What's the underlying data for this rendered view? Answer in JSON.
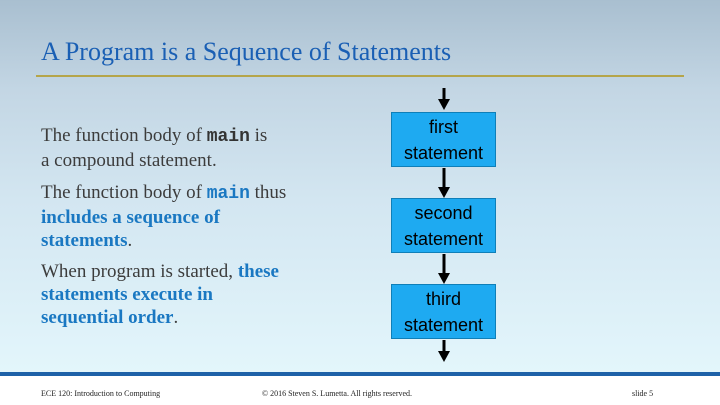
{
  "slide": {
    "title": "A Program is a Sequence of Statements",
    "paragraphs": {
      "p1": {
        "pre": "The function body of ",
        "code": "main",
        "post": " is",
        "line2": "a compound statement."
      },
      "p2": {
        "pre": "The function body of ",
        "code": "main",
        "post": " thus",
        "emph_line1": "includes a sequence of",
        "emph_line2": "statements",
        "tail": "."
      },
      "p3": {
        "pre": "When program is started, ",
        "emph_a": "these",
        "emph_line2": "statements execute in",
        "emph_line3": "sequential order",
        "tail": "."
      }
    },
    "flow": [
      {
        "line1": "first",
        "line2": "statement"
      },
      {
        "line1": "second",
        "line2": "statement"
      },
      {
        "line1": "third",
        "line2": "statement"
      }
    ],
    "footer": {
      "course": "ECE 120: Introduction to Computing",
      "copyright": "© 2016 Steven S. Lumetta.  All rights reserved.",
      "slide_number": "slide 5"
    }
  },
  "colors": {
    "title": "#1a5fb4",
    "emphasis": "#1a78c2",
    "box_fill": "#1eaaf1",
    "rule": "#b5a54a",
    "footer_bar": "#1e62a8"
  },
  "icons": {
    "flow_arrow": "down-arrow-icon"
  }
}
